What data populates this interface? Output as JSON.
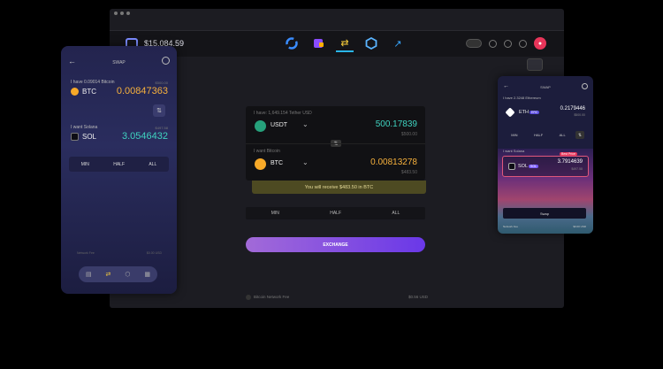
{
  "colors": {
    "accent": "#7c5cff",
    "bitcoin": "#f7a928",
    "tether": "#26a17b",
    "green_amount": "#3fd3c0",
    "orange_amount": "#f7b13c",
    "receive_bg": "#4d4a22"
  },
  "desktop": {
    "balance": "$15,084.59",
    "nav_icons": [
      "portfolio-icon",
      "wallet-icon",
      "exchange-icon",
      "apps-icon",
      "chart-icon"
    ],
    "send_row": {
      "label": "I have: 1,649.154 Tether USD",
      "ticker": "USDT",
      "amount": "500.17839",
      "sub": "$500.00"
    },
    "receive_row": {
      "label": "I want Bitcoin",
      "ticker": "BTC",
      "amount": "0.00813278",
      "sub": "$483.50"
    },
    "receive_note": "You will receive $483.50 in BTC",
    "percent_buttons": [
      "MIN",
      "HALF",
      "ALL"
    ],
    "exchange_label": "EXCHANGE",
    "fee_label": "Bitcoin Network Fee",
    "fee_value": "$0.56 USD"
  },
  "left_phone": {
    "title": "SWAP",
    "have_label": "I have 0.09014 Bitcoin",
    "have_sub": "$500.00",
    "have_ticker": "BTC",
    "have_amount": "0.00847363",
    "want_label": "I want Solana",
    "want_sub": "$497.58",
    "want_ticker": "SOL",
    "want_amount": "3.0546432",
    "percent_buttons": [
      "MIN",
      "HALF",
      "ALL"
    ],
    "fee_label": "Network Fee",
    "fee_value": "$0.00 USD"
  },
  "right_phone": {
    "title": "SWAP",
    "have_label": "I have 2.3248 Ethereum",
    "have_ticker": "ETH",
    "have_badge": "ERC",
    "have_amount": "0.2179446",
    "have_sub": "$500.00",
    "percent_buttons": [
      "MIN",
      "HALF",
      "ALL"
    ],
    "want_label": "I want Solana",
    "best_price": "Best Price",
    "want_ticker": "SOL",
    "want_badge": "SOL",
    "want_amount": "3.7914639",
    "want_sub": "$497.58",
    "swap_label": "Swap",
    "fee_label": "Network Fee",
    "fee_value": "$0.00 USD"
  }
}
